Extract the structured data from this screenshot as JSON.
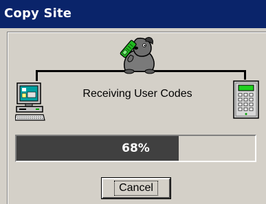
{
  "window": {
    "title": "Copy Site"
  },
  "status": {
    "text": "Receiving User Codes"
  },
  "progress": {
    "value": 0.68,
    "label": "68%"
  },
  "buttons": {
    "cancel_label": "Cancel"
  },
  "icons": {
    "center": "dog-with-phone-icon",
    "left": "computer-icon",
    "right": "keypad-panel-icon"
  },
  "colors": {
    "titlebar": "#0a246a",
    "progress_fill": "#404040",
    "window_bg": "#d4d0c8"
  }
}
